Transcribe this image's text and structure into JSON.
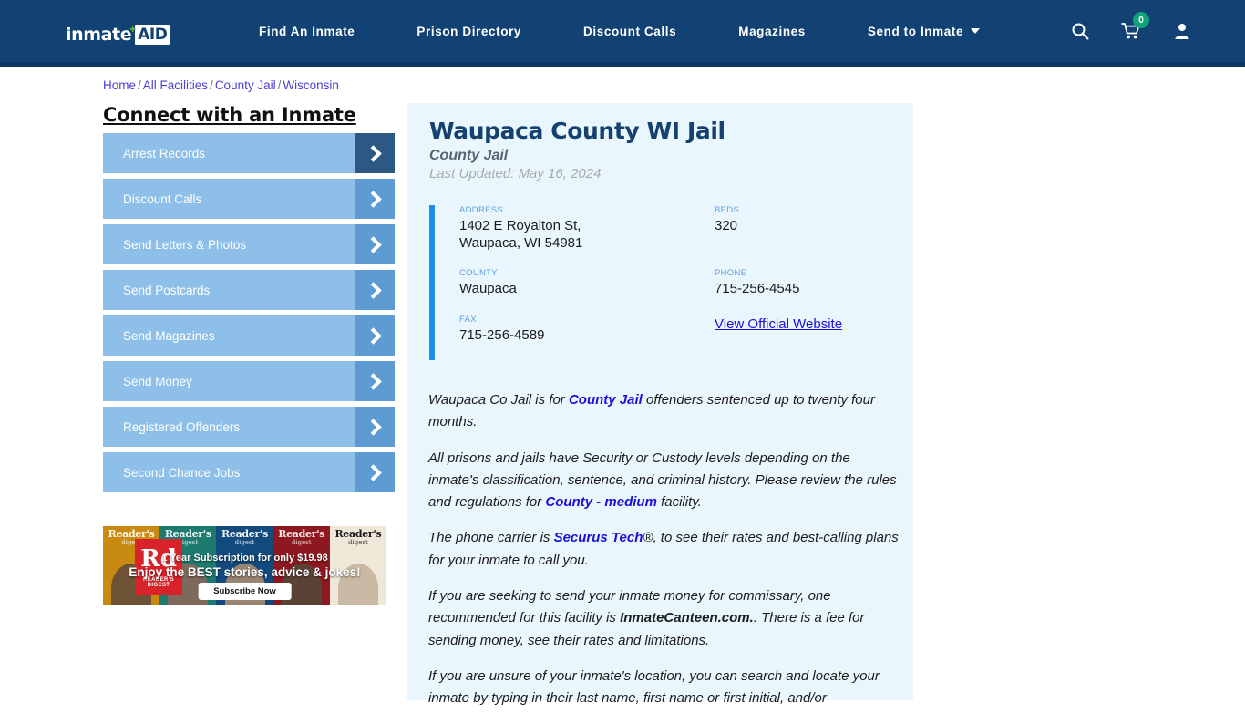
{
  "header": {
    "logo": {
      "word": "inmate",
      "plus": "+",
      "aid": "AID"
    },
    "nav": [
      {
        "label": "Find An Inmate",
        "caret": false
      },
      {
        "label": "Prison Directory",
        "caret": false
      },
      {
        "label": "Discount Calls",
        "caret": false
      },
      {
        "label": "Magazines",
        "caret": false
      },
      {
        "label": "Send to Inmate",
        "caret": true
      }
    ],
    "icons": {
      "search": "search-icon",
      "cart": "cart-icon",
      "cart_count": "0",
      "account": "user-icon"
    },
    "colors": {
      "bar": "#114273",
      "badge": "#0fa57a",
      "logo_plus": "#6cbf43"
    }
  },
  "breadcrumb": {
    "items": [
      "Home",
      "All Facilities",
      "County Jail",
      "Wisconsin"
    ],
    "separator": "/"
  },
  "sidebar": {
    "title": "Connect with an Inmate",
    "buttons": [
      {
        "label": "Arrest Records",
        "active": true
      },
      {
        "label": "Discount Calls",
        "active": false
      },
      {
        "label": "Send Letters & Photos",
        "active": false
      },
      {
        "label": "Send Postcards",
        "active": false
      },
      {
        "label": "Send Magazines",
        "active": false
      },
      {
        "label": "Send Money",
        "active": false
      },
      {
        "label": "Registered Offenders",
        "active": false
      },
      {
        "label": "Second Chance Jobs",
        "active": false
      }
    ]
  },
  "ad": {
    "brand": "Reader's",
    "brand_sub": "digest",
    "logo_mark": "Rd",
    "logo_line1": "READER'S",
    "logo_line2": "DIGEST",
    "headline1": "1 Year Subscription for only $19.98",
    "headline2": "Enjoy the BEST stories, advice & jokes!",
    "cta": "Subscribe Now"
  },
  "facility": {
    "title": "Waupaca County WI Jail",
    "subtitle": "County Jail",
    "last_updated": "Last Updated: May 16, 2024",
    "info": [
      {
        "label": "ADDRESS",
        "value": "1402 E Royalton St,\nWaupaca, WI 54981",
        "type": "text"
      },
      {
        "label": "BEDS",
        "value": "320",
        "type": "text"
      },
      {
        "label": "COUNTY",
        "value": "Waupaca",
        "type": "text"
      },
      {
        "label": "PHONE",
        "value": "715-256-4545",
        "type": "text"
      },
      {
        "label": "FAX",
        "value": "715-256-4589",
        "type": "text"
      },
      {
        "label": "",
        "value": "View Official Website",
        "type": "link"
      }
    ],
    "accent_color": "#1f8ce8",
    "panel_bg": "#eaf6fd"
  },
  "body": {
    "p1_a": "Waupaca Co Jail is for ",
    "p1_b": "County Jail",
    "p1_c": " offenders sentenced up to twenty four months.",
    "p2_a": "All prisons and jails have Security or Custody levels depending on the inmate's classification, sentence, and criminal history. Please review the rules and regulations for ",
    "p2_b": "County - medium",
    "p2_c": " facility.",
    "p3_a": "The phone carrier is ",
    "p3_b": "Securus Tech",
    "p3_c": "®, to see their rates and best-calling plans for your inmate to call you.",
    "p4_a": "If you are seeking to send your inmate money for commissary, one recommended for this facility is ",
    "p4_b": "InmateCanteen.com.",
    "p4_c": ". There is a fee for sending money, see their rates and limitations.",
    "p5": "If you are unsure of your inmate's location, you can search and locate your inmate by typing in their last name, first name or first initial, and/or"
  }
}
